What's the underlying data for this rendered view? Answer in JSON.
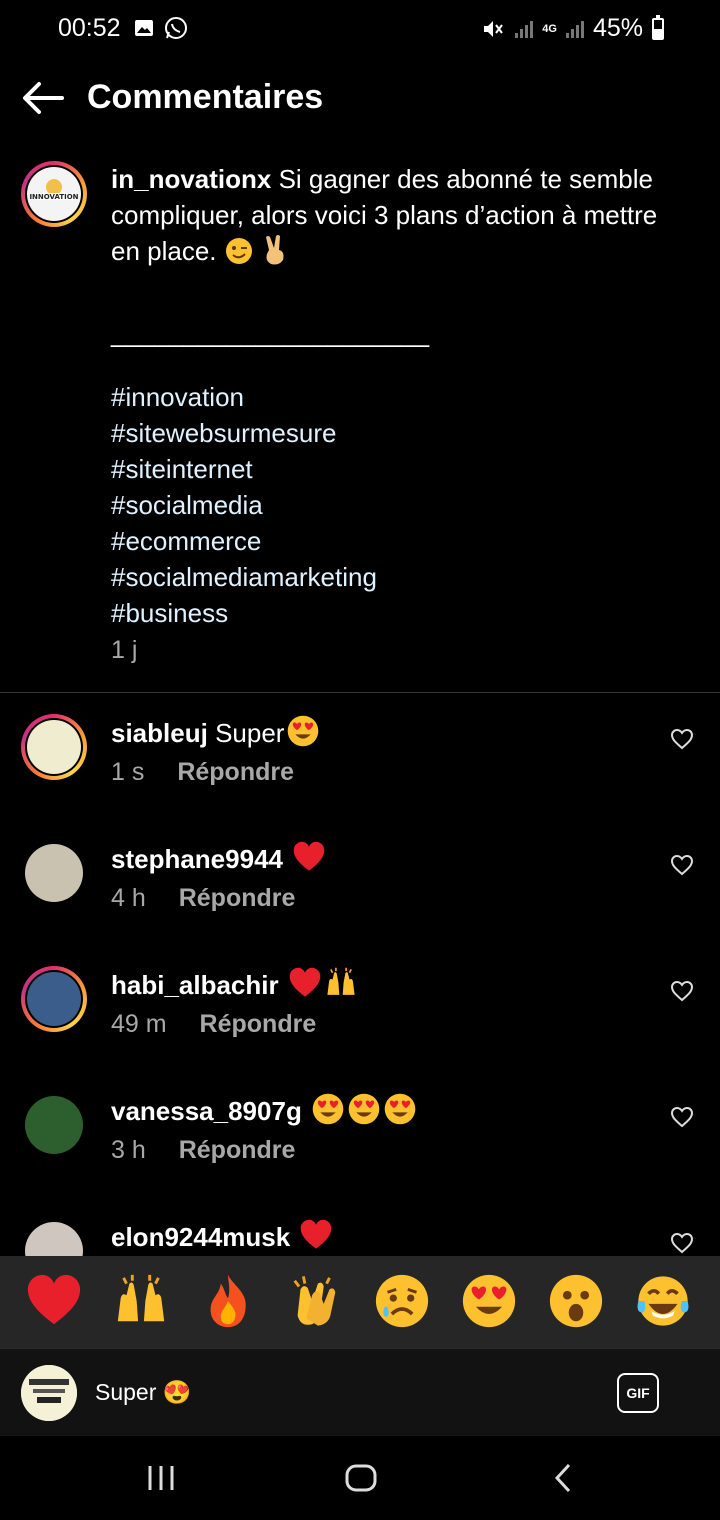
{
  "status_bar": {
    "time": "00:52",
    "battery": "45%",
    "battery_level": 0.45,
    "network": "4G"
  },
  "header": {
    "title": "Commentaires"
  },
  "caption": {
    "username": "in_novationx",
    "text": "Si gagner des abonné te semble compliquer, alors voici 3 plans d’action à mettre en place.",
    "separator": "______________________",
    "hashtags": [
      "#innovation",
      "#sitewebsurmesure",
      "#siteinternet",
      "#socialmedia",
      "#ecommerce",
      "#socialmediamarketing",
      "#business"
    ],
    "time": "1 j"
  },
  "comments": [
    {
      "username": "siableuj",
      "text": "Super",
      "emojis": [
        "heart-eyes"
      ],
      "time": "1 s",
      "reply": "Répondre",
      "story_ring": true
    },
    {
      "username": "stephane9944",
      "text": "",
      "emojis": [
        "red-heart"
      ],
      "time": "4 h",
      "reply": "Répondre",
      "story_ring": false
    },
    {
      "username": "habi_albachir",
      "text": "",
      "emojis": [
        "red-heart",
        "raising-hands"
      ],
      "time": "49 m",
      "reply": "Répondre",
      "story_ring": true
    },
    {
      "username": "vanessa_8907g",
      "text": "",
      "emojis": [
        "heart-eyes",
        "heart-eyes",
        "heart-eyes"
      ],
      "time": "3 h",
      "reply": "Répondre",
      "story_ring": false
    },
    {
      "username": "elon9244musk",
      "text": "",
      "emojis": [
        "red-heart"
      ],
      "time": "",
      "reply": "",
      "story_ring": false
    }
  ],
  "emoji_bar": [
    "red-heart",
    "raising-hands",
    "fire",
    "clapping-hands",
    "sad-face",
    "heart-eyes",
    "surprised-face",
    "tears-of-joy"
  ],
  "input": {
    "value": "Super 😍",
    "gif_label": "GIF"
  },
  "colors": {
    "background": "#000000",
    "muted": "#a8a8a8",
    "emoji_bar": "#262626",
    "heart": "#e8202c"
  }
}
